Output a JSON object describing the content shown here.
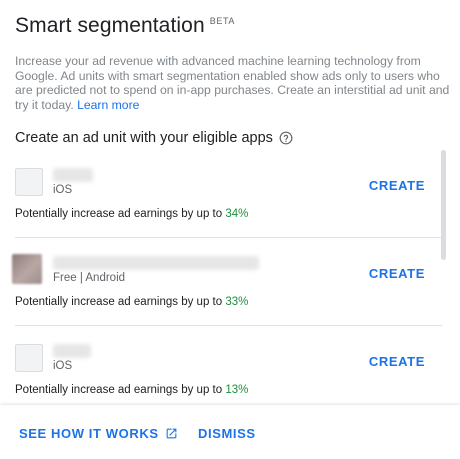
{
  "dialog": {
    "title": "Smart segmentation",
    "badge": "BETA",
    "description": "Increase your ad revenue with advanced machine learning technology from Google. Ad units with smart segmentation enabled show ads only to users who are predicted not to spend on in-app purchases. Create an interstitial ad unit and try it today.",
    "learn_more": "Learn more",
    "section_title": "Create an ad unit with your eligible apps",
    "help_icon": "help-circle-icon"
  },
  "apps": [
    {
      "platform": "iOS",
      "create_label": "CREATE",
      "earn_text": "Potentially increase ad earnings by up to",
      "earn_pct": "34%"
    },
    {
      "platform": "Free | Android",
      "create_label": "CREATE",
      "earn_text": "Potentially increase ad earnings by up to",
      "earn_pct": "33%"
    },
    {
      "platform": "iOS",
      "create_label": "CREATE",
      "earn_text": "Potentially increase ad earnings by up to",
      "earn_pct": "13%"
    }
  ],
  "footer": {
    "see_how": "SEE HOW IT WORKS",
    "see_how_icon": "open-in-new-icon",
    "dismiss": "DISMISS"
  },
  "colors": {
    "accent": "#1a73e8",
    "positive": "#1e8e3e",
    "muted": "#80868b"
  }
}
